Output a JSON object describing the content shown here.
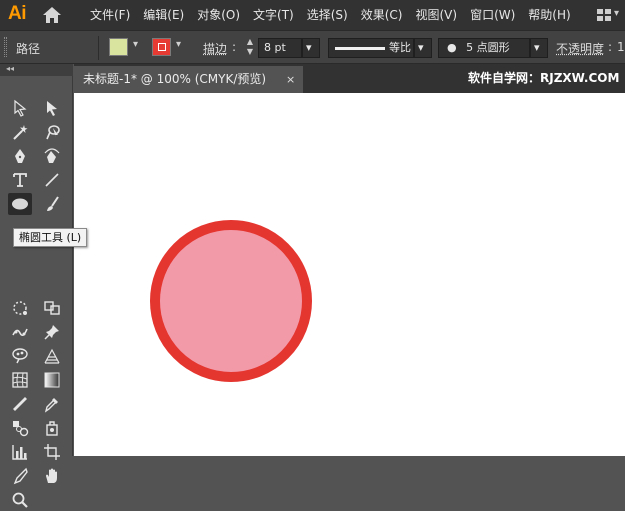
{
  "app": {
    "logo": "Ai"
  },
  "menu": [
    "文件(F)",
    "编辑(E)",
    "对象(O)",
    "文字(T)",
    "选择(S)",
    "效果(C)",
    "视图(V)",
    "窗口(W)",
    "帮助(H)"
  ],
  "control": {
    "selection_label": "路径",
    "fill_color": "#d9e49e",
    "stroke_color": "#e53b32",
    "stroke_label": "描边",
    "stroke_value": "8 pt",
    "profile_label": "等比",
    "brush_label": "5 点圆形",
    "opacity_label": "不透明度",
    "opacity_value": "1"
  },
  "toolbar": {
    "collapse": "◂◂",
    "active_tool": "ellipse-tool",
    "tooltip": "椭圆工具 (L)"
  },
  "document": {
    "tab_title": "未标题-1* @ 100% (CMYK/预览)",
    "close": "×",
    "watermark": "软件自学网：RJZXW.COM"
  },
  "shape": {
    "fill": "#f39aa9",
    "stroke": "#e5352f"
  }
}
